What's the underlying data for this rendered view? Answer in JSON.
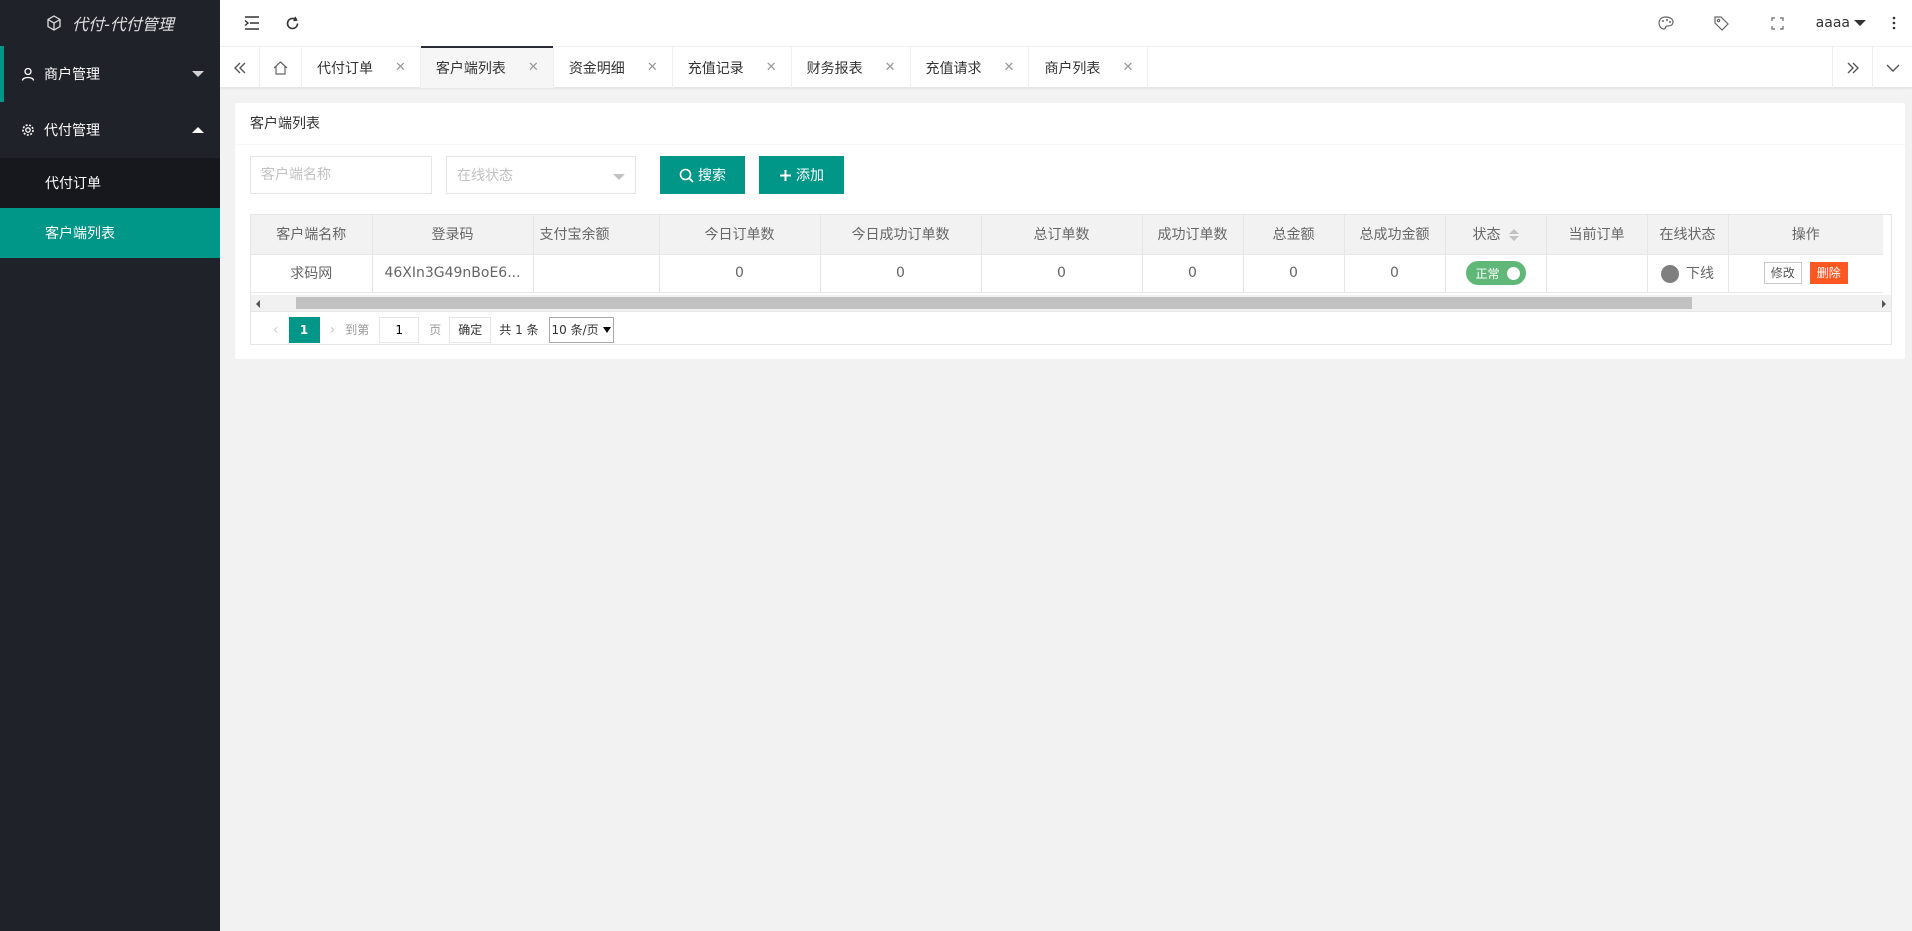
{
  "app": {
    "title": "代付-代付管理"
  },
  "sidebar": {
    "groups": [
      {
        "label": "商户管理",
        "icon": "user-icon",
        "expanded": false
      },
      {
        "label": "代付管理",
        "icon": "gear-icon",
        "expanded": true,
        "items": [
          {
            "label": "代付订单",
            "selected": false
          },
          {
            "label": "客户端列表",
            "selected": true
          }
        ]
      }
    ]
  },
  "header": {
    "user": "aaaa"
  },
  "tabs": [
    {
      "label": "代付订单",
      "active": false
    },
    {
      "label": "客户端列表",
      "active": true
    },
    {
      "label": "资金明细",
      "active": false
    },
    {
      "label": "充值记录",
      "active": false
    },
    {
      "label": "财务报表",
      "active": false
    },
    {
      "label": "充值请求",
      "active": false
    },
    {
      "label": "商户列表",
      "active": false
    }
  ],
  "card": {
    "title": "客户端列表",
    "search_placeholder": "客户端名称",
    "status_select_placeholder": "在线状态",
    "search_button": "搜索",
    "add_button": "添加"
  },
  "table": {
    "columns": [
      "客户端名称",
      "登录码",
      "支付宝余额",
      "今日订单数",
      "今日成功订单数",
      "总订单数",
      "成功订单数",
      "总金额",
      "总成功金额",
      "状态",
      "当前订单",
      "在线状态",
      "操作"
    ],
    "rows": [
      {
        "name": "求码网",
        "login_code": "46XIn3G49nBoE6...",
        "alipay_balance": "",
        "today_orders": "0",
        "today_success_orders": "0",
        "total_orders": "0",
        "success_orders": "0",
        "total_amount": "0",
        "total_success_amount": "0",
        "status": "正常",
        "current_order": "",
        "online_status": "下线",
        "edit_label": "修改",
        "delete_label": "删除"
      }
    ]
  },
  "pager": {
    "current_page": "1",
    "goto_label": "到第",
    "goto_value": "1",
    "page_unit": "页",
    "confirm": "确定",
    "total": "共 1 条",
    "page_size": "10 条/页"
  },
  "colors": {
    "primary": "#009688",
    "sidebar_bg": "#20222a",
    "switch_on": "#5fb878",
    "danger": "#ff5722"
  }
}
